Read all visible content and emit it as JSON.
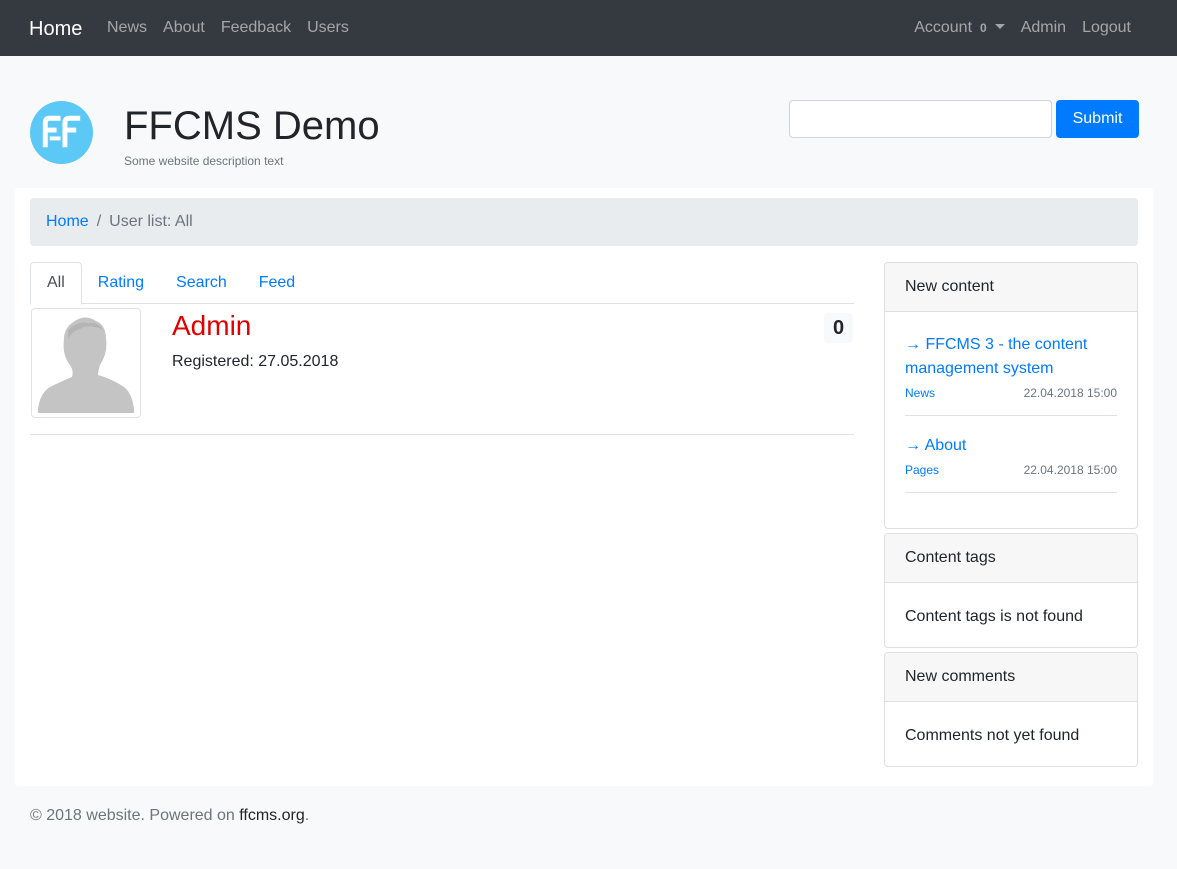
{
  "navbar": {
    "brand": "Home",
    "links_left": [
      "News",
      "About",
      "Feedback",
      "Users"
    ],
    "account_label": "Account",
    "account_badge": "0",
    "admin_label": "Admin",
    "logout_label": "Logout"
  },
  "header": {
    "site_title": "FFCMS Demo",
    "site_description": "Some website description text",
    "search_placeholder": "",
    "submit_label": "Submit"
  },
  "breadcrumb": {
    "home": "Home",
    "separator": "/",
    "current": "User list: All"
  },
  "tabs": [
    "All",
    "Rating",
    "Search",
    "Feed"
  ],
  "active_tab": "All",
  "users": [
    {
      "name": "Admin",
      "registered": "Registered: 27.05.2018",
      "rating": "0"
    }
  ],
  "sidebar": {
    "new_content": {
      "title": "New content",
      "items": [
        {
          "title": "→ FFCMS 3 - the content management system",
          "category": "News",
          "date": "22.04.2018 15:00"
        },
        {
          "title": "→ About",
          "category": "Pages",
          "date": "22.04.2018 15:00"
        }
      ]
    },
    "content_tags": {
      "title": "Content tags",
      "text": "Content tags is not found"
    },
    "new_comments": {
      "title": "New comments",
      "text": "Comments not yet found"
    }
  },
  "footer": {
    "text": "© 2018 website. Powered on ",
    "link": "ffcms.org",
    "suffix": "."
  },
  "colors": {
    "navbar_bg": "#343a40",
    "accent": "#007bff",
    "username": "#e00000",
    "logo": "#5bc8f5"
  }
}
